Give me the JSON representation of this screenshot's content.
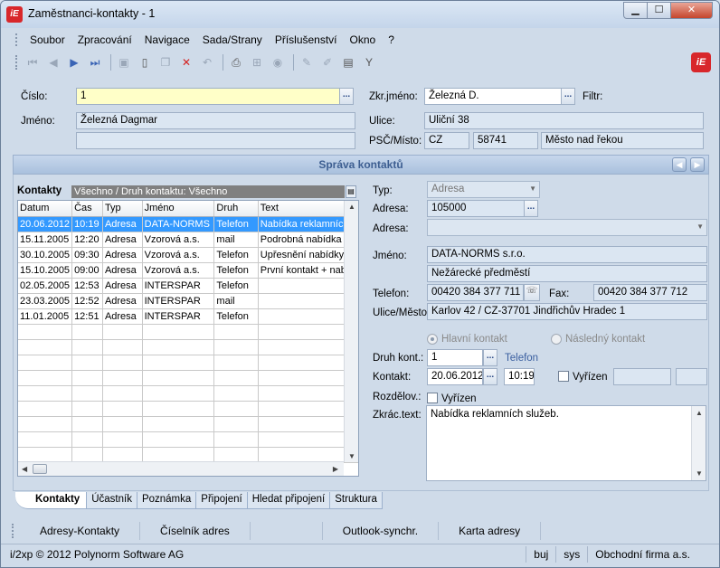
{
  "window": {
    "title": "Zaměstnanci-kontakty - 1",
    "logo": "iE",
    "min": "▁",
    "max": "☐",
    "close": "✕"
  },
  "menu": [
    "Soubor",
    "Zpracování",
    "Navigace",
    "Sada/Strany",
    "Příslušenství",
    "Okno",
    "?"
  ],
  "toolbar": {
    "icons": [
      "first-record-icon",
      "prev-record-icon",
      "next-record-icon",
      "last-record-icon",
      "save-icon",
      "new-icon",
      "copy-icon",
      "delete-icon",
      "undo-icon",
      "print-icon",
      "tree-icon",
      "refresh-icon",
      "edit-icon",
      "edit2-icon",
      "columns-icon",
      "filter-icon"
    ],
    "logo": "iE"
  },
  "form": {
    "cislo_label": "Číslo:",
    "cislo_value": "1",
    "jmeno_label": "Jméno:",
    "jmeno_value": "Železná Dagmar",
    "jmeno_value2": "",
    "zkr_label": "Zkr.jméno:",
    "zkr_value": "Železná D.",
    "filtr_label": "Filtr:",
    "ulice_label": "Ulice:",
    "ulice_value": "Uliční 38",
    "psc_label": "PSČ/Místo:",
    "stat": "CZ",
    "psc": "58741",
    "misto": "Město nad řekou",
    "dots": "..."
  },
  "section": {
    "title": "Správa kontaktů",
    "prev": "◀",
    "next": "▶"
  },
  "grid": {
    "title": "Kontakty",
    "filter": "Všechno / Druh kontaktu: Všechno",
    "columns": [
      "Datum",
      "Čas",
      "Typ",
      "Jméno",
      "Druh",
      "Text"
    ],
    "rows": [
      [
        "20.06.2012",
        "10:19",
        "Adresa",
        "DATA-NORMS",
        "Telefon",
        "Nabídka reklamních"
      ],
      [
        "15.11.2005",
        "12:20",
        "Adresa",
        "Vzorová a.s.",
        "mail",
        "Podrobná nabídka na"
      ],
      [
        "30.10.2005",
        "09:30",
        "Adresa",
        "Vzorová a.s.",
        "Telefon",
        "Upřesnění nabídky"
      ],
      [
        "15.10.2005",
        "09:00",
        "Adresa",
        "Vzorová a.s.",
        "Telefon",
        "První kontakt + nab"
      ],
      [
        "02.05.2005",
        "12:53",
        "Adresa",
        "INTERSPAR",
        "Telefon",
        ""
      ],
      [
        "23.03.2005",
        "12:52",
        "Adresa",
        "INTERSPAR",
        "mail",
        ""
      ],
      [
        "11.01.2005",
        "12:51",
        "Adresa",
        "INTERSPAR",
        "Telefon",
        ""
      ]
    ],
    "empty_rows": 9
  },
  "detail": {
    "typ_label": "Typ:",
    "typ_value": "Adresa",
    "adresa_label": "Adresa:",
    "adresa_value": "105000",
    "adresa2_label": "Adresa:",
    "adresa2_value": "",
    "jmeno_label": "Jméno:",
    "jmeno_value": "DATA-NORMS s.r.o.",
    "jmeno_value2": "Nežárecké předměstí",
    "telefon_label": "Telefon:",
    "telefon_value": "00420 384 377 711",
    "fax_label": "Fax:",
    "fax_value": "00420 384 377 712",
    "ulice_label": "Ulice/Město",
    "ulice_value": "Karlov 42 / CZ-37701 Jindřichův Hradec 1",
    "hlavni": "Hlavní kontakt",
    "nasledny": "Následný kontakt",
    "druh_label": "Druh kont.:",
    "druh_value": "1",
    "druh_text": "Telefon",
    "kontakt_label": "Kontakt:",
    "kontakt_date": "20.06.2012",
    "kontakt_time": "10:19",
    "vyrizen": "Vyřízen",
    "rozdelov_label": "Rozdělov.:",
    "vyrizen2": "Vyřízen",
    "zkrac_label": "Zkrác.text:",
    "zkrac_value": "Nabídka reklamních služeb."
  },
  "tabs": [
    "Kontakty",
    "Účastník",
    "Poznámka",
    "Připojení",
    "Hledat připojení",
    "Struktura"
  ],
  "bottom": [
    "Adresy-Kontakty",
    "Číselník adres",
    "Outlook-synchr.",
    "Karta adresy"
  ],
  "status": {
    "main": "i/2xp © 2012 Polynorm Software AG",
    "user": "buj",
    "sys": "sys",
    "firm": "Obchodní firma a.s."
  }
}
